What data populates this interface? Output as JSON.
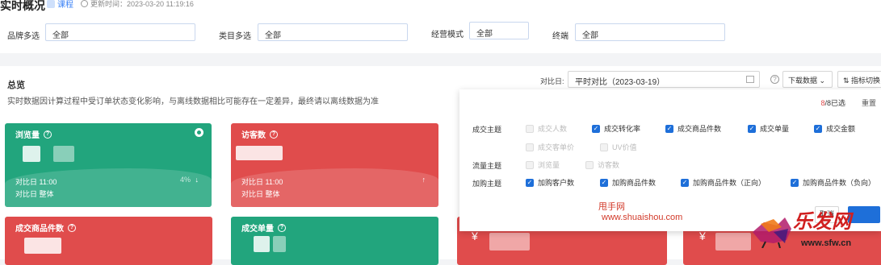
{
  "header": {
    "title": "实时概况",
    "tag": "课程",
    "updated": "更新时间：2023-03-20 11:19:16"
  },
  "filters": [
    {
      "label": "品牌多选",
      "value": "全部"
    },
    {
      "label": "类目多选",
      "value": "全部"
    },
    {
      "label": "经营模式",
      "value": "全部"
    },
    {
      "label": "终端",
      "value": "全部"
    }
  ],
  "overview": {
    "title": "总览",
    "notice": "实时数据因计算过程中受订单状态变化影响，与离线数据相比可能存在一定差异，最终请以离线数据为准",
    "compare_label": "对比日:",
    "compare_value": "平时对比（2023-03-19）",
    "download_label": "下载数据",
    "switch_label": "指标切换"
  },
  "cards": [
    {
      "title": "浏览量",
      "line1": "对比日 11:00",
      "line2": "对比日 整体",
      "pct": "4%",
      "arrow": "↓",
      "color": "#22a57d",
      "selected": true
    },
    {
      "title": "访客数",
      "line1": "对比日 11:00",
      "line2": "对比日 整体",
      "arrow": "↑",
      "color": "#e04c4c"
    },
    {
      "title": "成交商品件数",
      "color": "#e04c4c"
    },
    {
      "title": "成交单量",
      "color": "#22a57d"
    },
    {
      "currency": "¥",
      "color": "#e04c4c"
    },
    {
      "currency": "¥",
      "color": "#e04c4c"
    }
  ],
  "dropdown": {
    "count_selected": "8",
    "count_total": "/8已选",
    "reset": "重置",
    "cancel": "取消",
    "groups": [
      {
        "name": "成交主题",
        "options": [
          {
            "label": "成交人数",
            "state": "disabled"
          },
          {
            "label": "成交转化率",
            "state": "checked"
          },
          {
            "label": "成交商品件数",
            "state": "checked"
          },
          {
            "label": "成交单量",
            "state": "checked"
          },
          {
            "label": "成交金额",
            "state": "checked"
          },
          {
            "label": "成交客单价",
            "state": "disabled"
          },
          {
            "label": "UV价值",
            "state": "disabled"
          }
        ]
      },
      {
        "name": "流量主题",
        "options": [
          {
            "label": "浏览量",
            "state": "disabled"
          },
          {
            "label": "访客数",
            "state": "disabled"
          }
        ]
      },
      {
        "name": "加购主题",
        "options": [
          {
            "label": "加购客户数",
            "state": "checked"
          },
          {
            "label": "加购商品件数",
            "state": "checked"
          },
          {
            "label": "加购商品件数（正向）",
            "state": "checked"
          },
          {
            "label": "加购商品件数（负向）",
            "state": "checked"
          }
        ]
      }
    ]
  },
  "watermark": {
    "line1": "甩手网",
    "line2": "www.shuaishou.com",
    "logo_text": "乐发网",
    "logo_url": "www.sfw.cn"
  }
}
